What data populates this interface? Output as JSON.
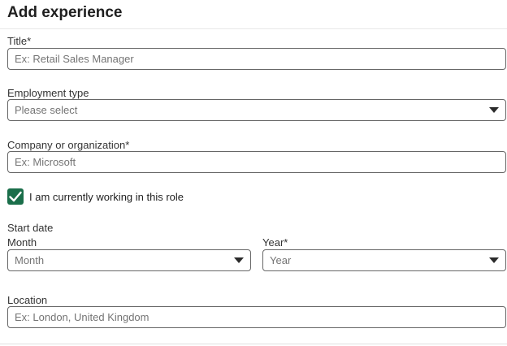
{
  "title": "Add experience",
  "fields": {
    "title": {
      "label": "Title*",
      "placeholder": "Ex: Retail Sales Manager"
    },
    "employment_type": {
      "label": "Employment type",
      "value": "Please select"
    },
    "company": {
      "label": "Company or organization*",
      "placeholder": "Ex: Microsoft"
    },
    "current_role": {
      "label": "I am currently working in this role",
      "checked": true
    },
    "start_date": {
      "label": "Start date",
      "month": {
        "label": "Month",
        "value": "Month"
      },
      "year": {
        "label": "Year*",
        "value": "Year"
      }
    },
    "location": {
      "label": "Location",
      "placeholder": "Ex: London, United Kingdom"
    }
  },
  "colors": {
    "checkbox": "#1a6e4a",
    "border": "#666666",
    "placeholder": "#747474"
  },
  "icons": {
    "dropdown": "caret-down-icon",
    "check": "checkmark-icon"
  }
}
